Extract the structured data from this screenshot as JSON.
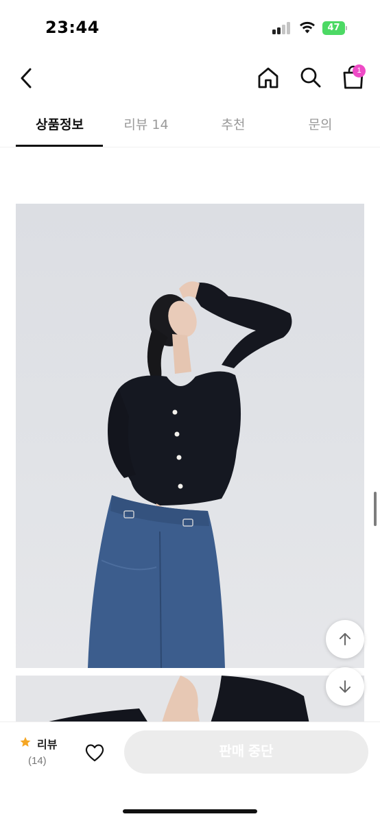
{
  "status_bar": {
    "time": "23:44",
    "battery": "47"
  },
  "header": {
    "back_icon": "chevron-left-icon",
    "home_icon": "home-icon",
    "search_icon": "search-icon",
    "cart_icon": "shopping-bag-icon",
    "cart_count": "1"
  },
  "tabs": [
    {
      "label": "상품정보",
      "active": true
    },
    {
      "label": "리뷰 14",
      "active": false
    },
    {
      "label": "추천",
      "active": false
    },
    {
      "label": "문의",
      "active": false
    }
  ],
  "floating_buttons": {
    "up_icon": "arrow-up-icon",
    "down_icon": "arrow-down-icon"
  },
  "bottom_bar": {
    "review_label": "리뷰",
    "review_count": "(14)",
    "wishlist_icon": "heart-icon",
    "status_button": "판매 중단"
  },
  "colors": {
    "accent_badge": "#ee4bc6",
    "star": "#f5a623",
    "battery": "#4cd964",
    "disabled_button": "#ececec"
  }
}
